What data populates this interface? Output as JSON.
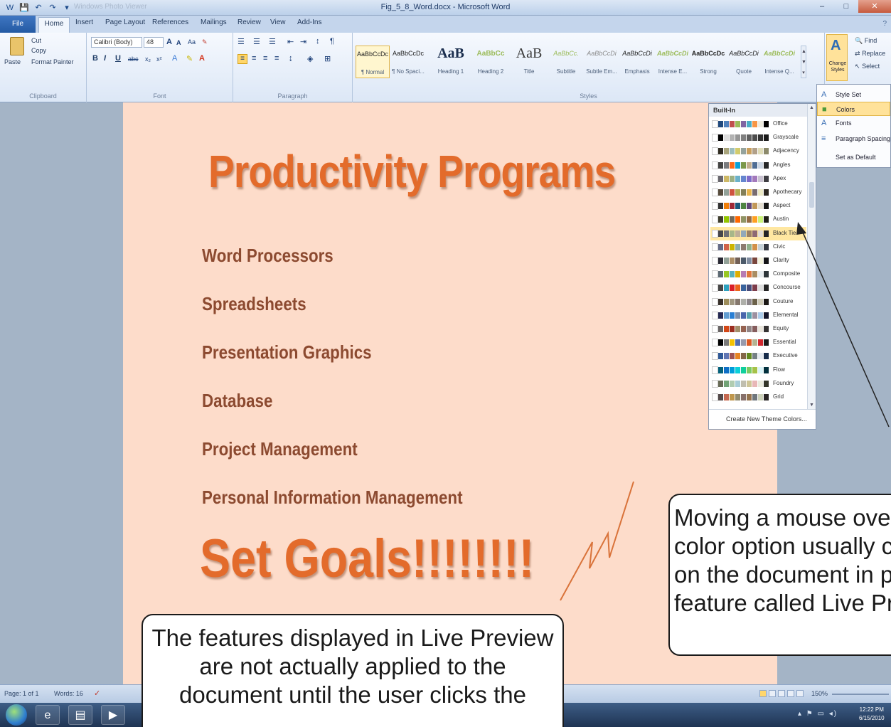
{
  "window": {
    "title": "Fig_5_8_Word.docx - Microsoft Word",
    "qat_app_name": "Windows Photo Viewer",
    "qat_buttons": [
      "W",
      "💾",
      "↶",
      "↷",
      "▾"
    ],
    "controls": [
      "–",
      "□",
      "✕"
    ]
  },
  "tabs": [
    "File",
    "Home",
    "Insert",
    "Page Layout",
    "References",
    "Mailings",
    "Review",
    "View",
    "Add-Ins"
  ],
  "ribbon": {
    "clipboard": {
      "label": "Clipboard",
      "paste": "Paste",
      "cut": "Cut",
      "copy": "Copy",
      "format_painter": "Format Painter"
    },
    "font": {
      "label": "Font",
      "font_name": "Calibri (Body)",
      "font_size": "48",
      "bold": "B",
      "italic": "I",
      "underline": "U"
    },
    "paragraph": {
      "label": "Paragraph"
    },
    "styles": {
      "label": "Styles",
      "tiles": [
        {
          "sample": "AaBbCcDc",
          "name": "¶ Normal"
        },
        {
          "sample": "AaBbCcDc",
          "name": "¶ No Spaci..."
        },
        {
          "sample": "AaB",
          "name": "Heading 1"
        },
        {
          "sample": "AaBbCc",
          "name": "Heading 2"
        },
        {
          "sample": "AaB",
          "name": "Title"
        },
        {
          "sample": "AaBbCc.",
          "name": "Subtitle"
        },
        {
          "sample": "AaBbCcDi",
          "name": "Subtle Em..."
        },
        {
          "sample": "AaBbCcDi",
          "name": "Emphasis"
        },
        {
          "sample": "AaBbCcDi",
          "name": "Intense E..."
        },
        {
          "sample": "AaBbCcDc",
          "name": "Strong"
        },
        {
          "sample": "AaBbCcDi",
          "name": "Quote"
        },
        {
          "sample": "AaBbCcDi",
          "name": "Intense Q..."
        }
      ],
      "change_styles": "Change Styles"
    },
    "editing": {
      "find": "Find",
      "replace": "Replace",
      "select": "Select"
    }
  },
  "styles_menu": {
    "items": [
      {
        "icon": "A",
        "label": "Style Set"
      },
      {
        "icon": "■",
        "label": "Colors"
      },
      {
        "icon": "A",
        "label": "Fonts"
      },
      {
        "icon": "≡",
        "label": "Paragraph Spacing"
      },
      {
        "icon": "",
        "label": "Set as Default"
      }
    ]
  },
  "colors_gallery": {
    "header": "Built-In",
    "highlighted_index": 8,
    "themes": [
      {
        "name": "Office",
        "colors": [
          "#ffffff",
          "#1f497d",
          "#4f81bd",
          "#c0504d",
          "#9bbb59",
          "#8064a2",
          "#4bacc6",
          "#f79646",
          "#eeece1",
          "#000000"
        ]
      },
      {
        "name": "Grayscale",
        "colors": [
          "#ffffff",
          "#000000",
          "#dddddd",
          "#b2b2b2",
          "#969696",
          "#808080",
          "#5f5f5f",
          "#4d4d4d",
          "#333333",
          "#1a1a1a"
        ]
      },
      {
        "name": "Adjacency",
        "colors": [
          "#ffffff",
          "#2f2b20",
          "#a9a57c",
          "#9cbebd",
          "#d2cb6c",
          "#95a39d",
          "#c89f5d",
          "#b1a089",
          "#dfdcb7",
          "#8c8a6b"
        ]
      },
      {
        "name": "Angles",
        "colors": [
          "#ffffff",
          "#434342",
          "#797b7e",
          "#f96a1b",
          "#08a1d9",
          "#7c984a",
          "#c2ad8d",
          "#506e94",
          "#cdd6e2",
          "#262626"
        ]
      },
      {
        "name": "Apex",
        "colors": [
          "#ffffff",
          "#69676d",
          "#ceb966",
          "#9cb084",
          "#6bb1c9",
          "#6585cf",
          "#7e6bc9",
          "#a379bb",
          "#c9c2d1",
          "#3e3d42"
        ]
      },
      {
        "name": "Apothecary",
        "colors": [
          "#ffffff",
          "#564b3c",
          "#93a299",
          "#cf543f",
          "#b5ae53",
          "#848058",
          "#e8b54d",
          "#786c71",
          "#ece9c6",
          "#2b2620"
        ]
      },
      {
        "name": "Aspect",
        "colors": [
          "#ffffff",
          "#323232",
          "#f07f09",
          "#9f2936",
          "#1b587c",
          "#4e8542",
          "#604878",
          "#c19859",
          "#e3ded1",
          "#151515"
        ]
      },
      {
        "name": "Austin",
        "colors": [
          "#ffffff",
          "#3e3d2d",
          "#94c600",
          "#71685a",
          "#ff6700",
          "#909465",
          "#956b43",
          "#fea022",
          "#caf278",
          "#1f1e16"
        ]
      },
      {
        "name": "Black Tie",
        "colors": [
          "#ffffff",
          "#46464a",
          "#6f6f74",
          "#a7b789",
          "#beae98",
          "#92a9b9",
          "#9c8265",
          "#8d6974",
          "#e3dcd3",
          "#232325"
        ]
      },
      {
        "name": "Civic",
        "colors": [
          "#ffffff",
          "#646b86",
          "#d16349",
          "#ccb400",
          "#8cadae",
          "#8c7b70",
          "#8fb08c",
          "#d19049",
          "#c5d1d7",
          "#32363f"
        ]
      },
      {
        "name": "Clarity",
        "colors": [
          "#ffffff",
          "#292934",
          "#93a299",
          "#ad8f67",
          "#726056",
          "#4c5a6a",
          "#808da0",
          "#79463d",
          "#f3f2dc",
          "#151518"
        ]
      },
      {
        "name": "Composite",
        "colors": [
          "#ffffff",
          "#5b6973",
          "#98c723",
          "#59b0b9",
          "#deae00",
          "#b77bb4",
          "#e0773c",
          "#a98d63",
          "#e7ecef",
          "#2d3539"
        ]
      },
      {
        "name": "Concourse",
        "colors": [
          "#ffffff",
          "#464646",
          "#2da2bf",
          "#da1f28",
          "#eb641b",
          "#39639d",
          "#474b78",
          "#7d3c4a",
          "#dedede",
          "#232323"
        ]
      },
      {
        "name": "Couture",
        "colors": [
          "#ffffff",
          "#37302a",
          "#9e8e5c",
          "#a09781",
          "#85776d",
          "#aeafa9",
          "#8d878b",
          "#6b6149",
          "#d0ccb9",
          "#1b1815"
        ]
      },
      {
        "name": "Elemental",
        "colors": [
          "#ffffff",
          "#242852",
          "#629dd1",
          "#297fd5",
          "#7f8fa9",
          "#4a66ac",
          "#5aa2ae",
          "#9d90a0",
          "#acccea",
          "#121429"
        ]
      },
      {
        "name": "Equity",
        "colors": [
          "#ffffff",
          "#696464",
          "#d34817",
          "#9b2d1f",
          "#a28e6a",
          "#956251",
          "#918485",
          "#855d5d",
          "#e9e5dc",
          "#353232"
        ]
      },
      {
        "name": "Essential",
        "colors": [
          "#ffffff",
          "#000000",
          "#7a7a7a",
          "#f5c201",
          "#526db0",
          "#989aac",
          "#dc5924",
          "#b4b392",
          "#d1282e",
          "#1a1a1a"
        ]
      },
      {
        "name": "Executive",
        "colors": [
          "#ffffff",
          "#2f5897",
          "#6076b4",
          "#9c5252",
          "#e68422",
          "#846648",
          "#63891f",
          "#758085",
          "#e4e9ef",
          "#172c4b"
        ]
      },
      {
        "name": "Flow",
        "colors": [
          "#ffffff",
          "#04617b",
          "#0f6fc6",
          "#009dd9",
          "#0bd0d9",
          "#10cf9b",
          "#7cca62",
          "#a5c249",
          "#dbf5f9",
          "#02303d"
        ]
      },
      {
        "name": "Foundry",
        "colors": [
          "#ffffff",
          "#676a55",
          "#72a376",
          "#b0ccb0",
          "#a8cdd7",
          "#c0beaf",
          "#cec597",
          "#e8b7b7",
          "#eaebde",
          "#33352a"
        ]
      },
      {
        "name": "Grid",
        "colors": [
          "#ffffff",
          "#534949",
          "#c66951",
          "#bf974d",
          "#928b70",
          "#87706b",
          "#94734e",
          "#6f777d",
          "#ccd1b9",
          "#292424"
        ]
      }
    ],
    "footer": "Create New Theme Colors..."
  },
  "document": {
    "title": "Productivity Programs",
    "items": [
      "Word Processors",
      "Spreadsheets",
      "Presentation Graphics",
      "Database",
      "Project Management",
      "Personal Information Management"
    ],
    "goal": "Set Goals!!!!!!!!"
  },
  "callouts": {
    "right_lines": [
      "Moving a mouse over a",
      "color option usually changes",
      "on the document in preview",
      "feature called Live Preview"
    ],
    "bottom_lines": [
      "The features displayed in Live Preview",
      "are not actually applied to the",
      "document until the user clicks the"
    ]
  },
  "status": {
    "page": "Page: 1 of 1",
    "words": "Words: 16",
    "zoom": "150%"
  },
  "taskbar": {
    "clock_time": "12:22 PM",
    "clock_date": "6/15/2010"
  }
}
